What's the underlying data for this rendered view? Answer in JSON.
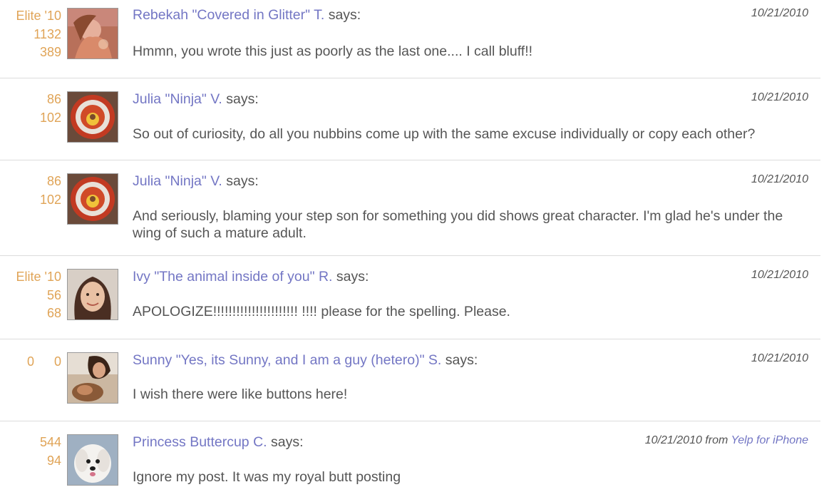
{
  "colors": {
    "author_link": "#7376c4",
    "stats": "#e0a457",
    "text": "#555555",
    "divider": "#dcdcdc"
  },
  "posts": [
    {
      "stats": [
        "Elite '10",
        "1132",
        "389"
      ],
      "author": "Rebekah \"Covered in Glitter\" T.",
      "says": " says:",
      "date": "10/21/2010",
      "body": "Hmmn, you wrote this just as poorly as the last one.... I call bluff!!"
    },
    {
      "stats": [
        "86",
        "102"
      ],
      "author": "Julia \"Ninja\" V.",
      "says": " says:",
      "date": "10/21/2010",
      "body": "So out of curiosity, do all you nubbins come up with the same excuse individually or copy each other?"
    },
    {
      "stats": [
        "86",
        "102"
      ],
      "author": "Julia \"Ninja\" V.",
      "says": " says:",
      "date": "10/21/2010",
      "body": "And seriously, blaming your step son for something you did shows great character.  I'm glad he's under the wing of such a mature adult."
    },
    {
      "stats": [
        "Elite '10",
        "56",
        "68"
      ],
      "author": "Ivy \"The animal inside of you\" R.",
      "says": " says:",
      "date": "10/21/2010",
      "body": "APOLOGIZE!!!!!!!!!!!!!!!!!!!!!! !!!! please for the spelling. Please."
    },
    {
      "stats": [
        "0",
        "0"
      ],
      "author": "Sunny \"Yes, its Sunny, and I am a guy (hetero)\" S.",
      "says": " says:",
      "date": "10/21/2010",
      "body": "I wish there were like buttons here!"
    },
    {
      "stats": [
        "544",
        "94"
      ],
      "author": "Princess Buttercup C.",
      "says": " says:",
      "date": "10/21/2010",
      "date_from": " from ",
      "source": "Yelp for iPhone",
      "body": "Ignore my post. It was my royal butt posting"
    }
  ]
}
